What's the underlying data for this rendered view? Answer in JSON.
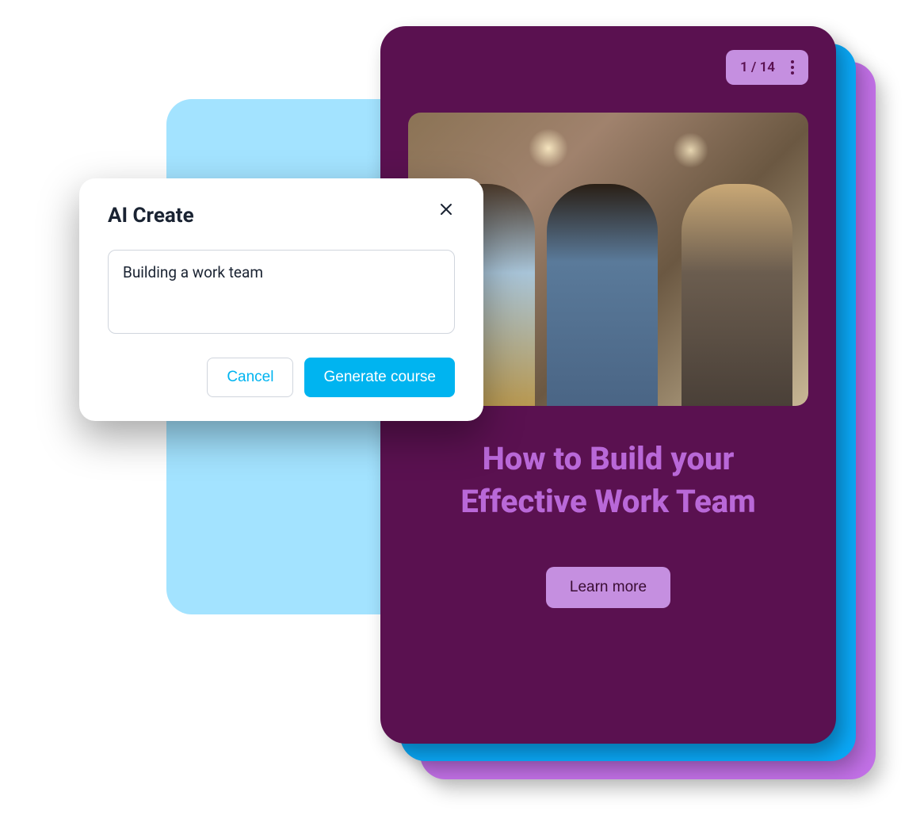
{
  "dialog": {
    "title": "AI Create",
    "input_value": "Building a work team",
    "cancel_label": "Cancel",
    "generate_label": "Generate course"
  },
  "course": {
    "page_counter": "1 / 14",
    "title": "How to Build your Effective Work Team",
    "learn_more_label": "Learn more"
  },
  "colors": {
    "primary_purple": "#5a1150",
    "accent_purple": "#c58fe0",
    "title_purple": "#b968d8",
    "cyan": "#00b4f0",
    "light_blue": "#a3e3ff",
    "bright_blue": "#0aa8f7",
    "bg_purple": "#c371e8"
  }
}
